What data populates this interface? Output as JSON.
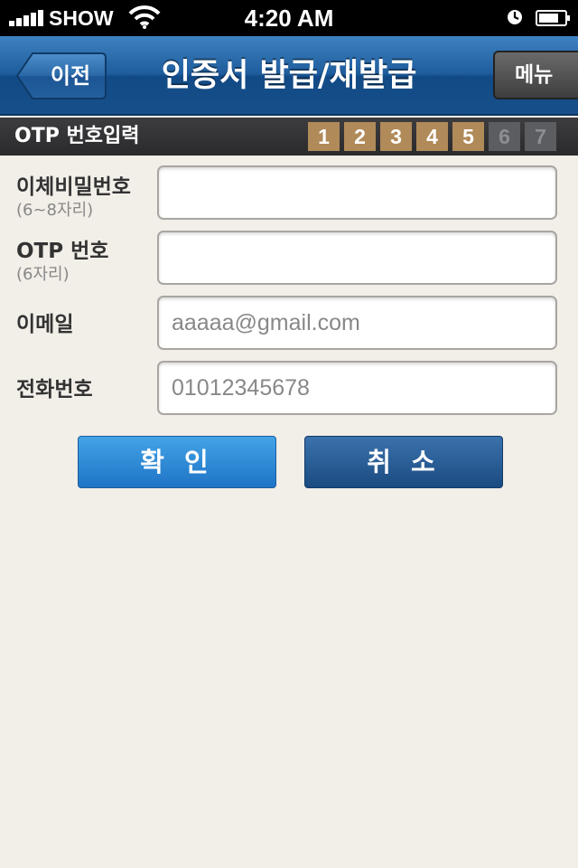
{
  "status_bar": {
    "carrier": "SHOW",
    "time": "4:20 AM"
  },
  "nav": {
    "back_label": "이전",
    "title": "인증서 발급/재발급",
    "menu_label": "메뉴"
  },
  "step_bar": {
    "title": "OTP 번호입력",
    "steps": [
      "1",
      "2",
      "3",
      "4",
      "5",
      "6",
      "7"
    ],
    "active_through": 5
  },
  "form": {
    "transfer_password": {
      "label": "이체비밀번호",
      "hint": "(6~8자리)",
      "value": ""
    },
    "otp": {
      "label": "OTP 번호",
      "hint": "(6자리)",
      "value": ""
    },
    "email": {
      "label": "이메일",
      "value": "aaaaa@gmail.com"
    },
    "phone": {
      "label": "전화번호",
      "value": "01012345678"
    }
  },
  "actions": {
    "confirm_label": "확 인",
    "cancel_label": "취 소"
  },
  "colors": {
    "nav_blue": "#1f5d9d",
    "step_active": "#b08a59",
    "step_inactive": "#5c5d61",
    "background": "#f2eee8"
  }
}
